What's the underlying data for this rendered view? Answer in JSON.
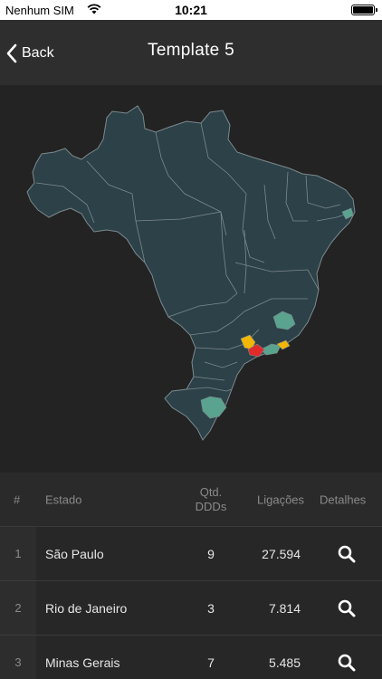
{
  "status_bar": {
    "carrier": "Nenhum SIM",
    "time": "10:21"
  },
  "nav": {
    "back_label": "Back",
    "title": "Template 5"
  },
  "map": {
    "base_color": "#2c4148",
    "border_color": "#7d8a8e",
    "highlight_colors": [
      "#5aa38f",
      "#f2b705",
      "#e02b2b"
    ]
  },
  "table": {
    "headers": {
      "index": "#",
      "estado": "Estado",
      "qtd_line1": "Qtd.",
      "qtd_line2": "DDDs",
      "ligacoes": "Ligações",
      "detalhes": "Detalhes"
    },
    "rows": [
      {
        "index": "1",
        "estado": "São Paulo",
        "qtd": "9",
        "ligacoes": "27.594"
      },
      {
        "index": "2",
        "estado": "Rio de Janeiro",
        "qtd": "3",
        "ligacoes": "7.814"
      },
      {
        "index": "3",
        "estado": "Minas Gerais",
        "qtd": "7",
        "ligacoes": "5.485"
      }
    ],
    "detail_icon": "search-icon"
  }
}
